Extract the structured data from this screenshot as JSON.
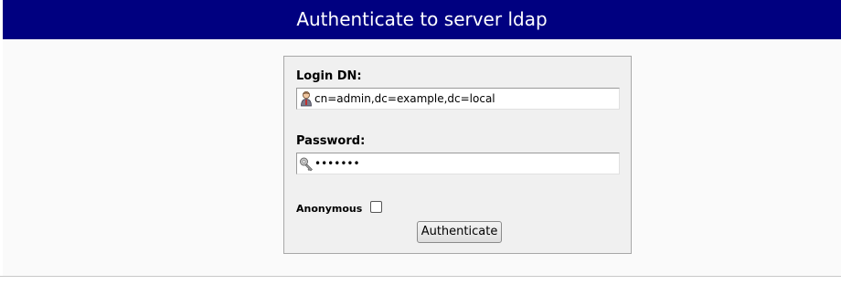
{
  "header": {
    "title": "Authenticate to server ldap"
  },
  "login_form": {
    "login_dn_label": "Login DN:",
    "login_dn_value": "cn=admin,dc=example,dc=local",
    "login_dn_icon": "user-icon",
    "password_label": "Password:",
    "password_value": "•••••••",
    "password_icon": "key-icon",
    "anonymous_label": "Anonymous",
    "anonymous_checked": false,
    "submit_label": "Authenticate"
  },
  "colors": {
    "title_bar": "#000080",
    "title_text": "#ffffff",
    "form_background": "#f0f0f0"
  }
}
